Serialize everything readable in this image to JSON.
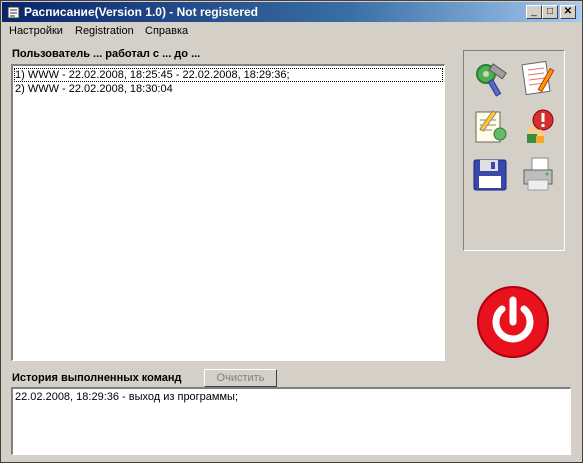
{
  "window": {
    "title": "Расписание(Version 1.0) - Not registered",
    "controls": {
      "minimize": "_",
      "maximize": "□",
      "close": "✕"
    }
  },
  "menu": {
    "items": [
      "Настройки",
      "Registration",
      "Справка"
    ]
  },
  "work_log": {
    "header": "Пользователь ... работал с ... до ...",
    "rows": [
      "1) WWW - 22.02.2008, 18:25:45 - 22.02.2008, 18:29:36;",
      "2) WWW - 22.02.2008, 18:30:04"
    ]
  },
  "tools": [
    "settings-tools-icon",
    "notepad-edit-icon",
    "edit-document-icon",
    "user-alert-icon",
    "save-floppy-icon",
    "printer-icon"
  ],
  "history": {
    "header": "История выполненных команд",
    "clear_label": "Очистить",
    "rows": [
      "22.02.2008, 18:29:36 - выход из программы;"
    ]
  },
  "power_button": {
    "icon": "power-icon",
    "color": "#e8121e"
  }
}
